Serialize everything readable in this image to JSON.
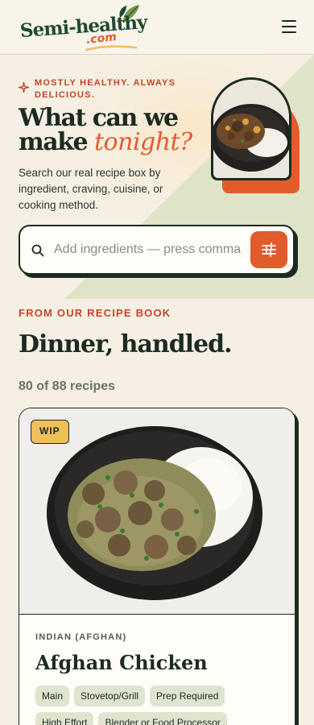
{
  "header": {
    "logo_main": "Semi-healthy",
    "logo_sub": ".com",
    "menu_icon": "hamburger-menu-icon"
  },
  "hero": {
    "eyebrow": "MOSTLY HEALTHY. ALWAYS DELICIOUS.",
    "title_line1": "What can we",
    "title_line2_plain": "make ",
    "title_line2_accent": "tonight?",
    "description": "Search our real recipe box by ingredient, craving, cuisine, or cooking method.",
    "search_placeholder": "Add ingredients — press comma",
    "search_value": "",
    "search_icon": "search-icon",
    "filter_icon": "sliders-filter-icon"
  },
  "recipes": {
    "section_label": "FROM OUR RECIPE BOOK",
    "section_title": "Dinner, handled.",
    "count_text": "80 of 88 recipes"
  },
  "card": {
    "badge": "WIP",
    "cuisine": "INDIAN (AFGHAN)",
    "name": "Afghan Chicken",
    "tags": [
      "Main",
      "Stovetop/Grill",
      "Prep Required",
      "High Effort",
      "Blender or Food Processor"
    ]
  },
  "colors": {
    "accent": "#e25b2c",
    "brand_green": "#1f4a30",
    "ink": "#1d2a22",
    "cream": "#f5f0e3",
    "badge": "#efc05a",
    "tag": "#dfe4cf"
  }
}
